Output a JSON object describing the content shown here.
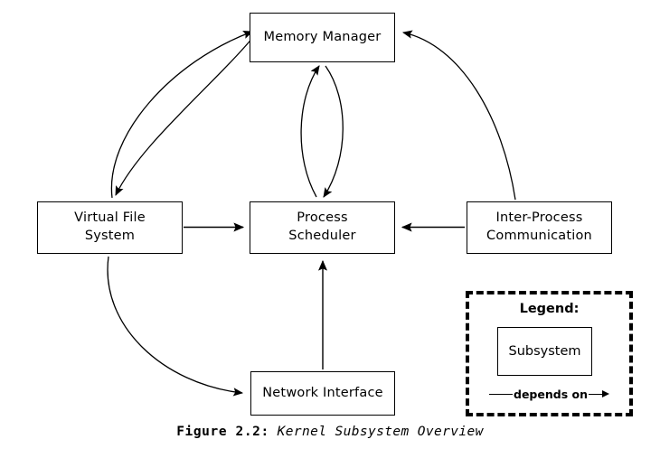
{
  "figure": {
    "caption_number": "Figure 2.2:",
    "caption_title": "Kernel Subsystem Overview"
  },
  "nodes": [
    {
      "id": "memory-manager",
      "label": "Memory Manager"
    },
    {
      "id": "virtual-file-system",
      "label": "Virtual File\nSystem"
    },
    {
      "id": "process-scheduler",
      "label": "Process\nScheduler"
    },
    {
      "id": "inter-process-communication",
      "label": "Inter-Process\nCommunication"
    },
    {
      "id": "network-interface",
      "label": "Network Interface"
    }
  ],
  "legend": {
    "title": "Legend:",
    "sample_box_label": "Subsystem",
    "edge_label": "depends on"
  },
  "colors": {
    "stroke": "#000000",
    "background": "#ffffff",
    "text": "#000000"
  },
  "chart_data": {
    "type": "diagram",
    "title": "Kernel Subsystem Overview",
    "nodes": [
      "Memory Manager",
      "Virtual File System",
      "Process Scheduler",
      "Inter-Process Communication",
      "Network Interface"
    ],
    "edges": [
      {
        "from": "Virtual File System",
        "to": "Memory Manager",
        "style": "curved",
        "relation": "depends on"
      },
      {
        "from": "Memory Manager",
        "to": "Virtual File System",
        "style": "curved",
        "relation": "depends on"
      },
      {
        "from": "Process Scheduler",
        "to": "Memory Manager",
        "style": "curved",
        "relation": "depends on"
      },
      {
        "from": "Memory Manager",
        "to": "Process Scheduler",
        "style": "curved",
        "relation": "depends on"
      },
      {
        "from": "Inter-Process Communication",
        "to": "Memory Manager",
        "style": "curved",
        "relation": "depends on"
      },
      {
        "from": "Virtual File System",
        "to": "Process Scheduler",
        "style": "straight",
        "relation": "depends on"
      },
      {
        "from": "Inter-Process Communication",
        "to": "Process Scheduler",
        "style": "straight",
        "relation": "depends on"
      },
      {
        "from": "Network Interface",
        "to": "Process Scheduler",
        "style": "straight",
        "relation": "depends on"
      },
      {
        "from": "Virtual File System",
        "to": "Network Interface",
        "style": "curved",
        "relation": "depends on"
      }
    ]
  }
}
